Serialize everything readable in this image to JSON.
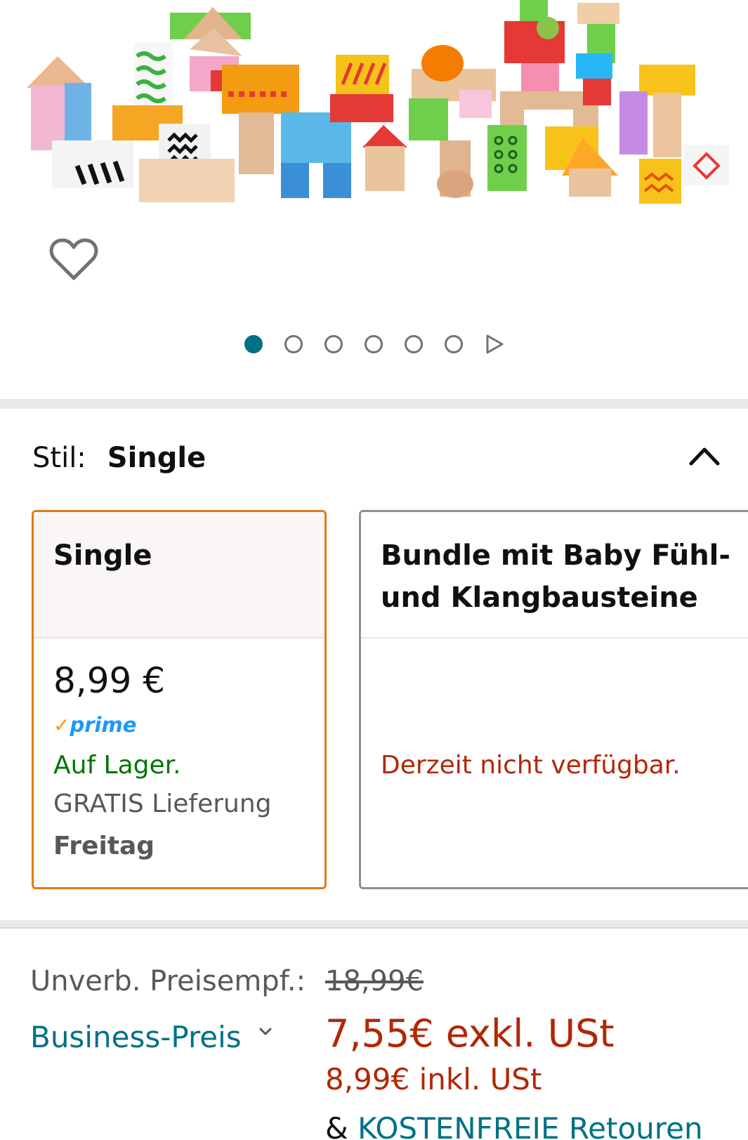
{
  "gallery": {
    "image_alt": "Holzbausteine",
    "wishlist_icon": "heart-outline-icon",
    "dots_total": 6,
    "active_dot_index": 0,
    "next_icon": "play-triangle-icon",
    "colors": {
      "active_dot": "#007185",
      "inactive_dot": "#6f7373"
    }
  },
  "style": {
    "label": "Stil:",
    "value": "Single",
    "toggle_icon": "chevron-up-icon"
  },
  "options": [
    {
      "title": "Single",
      "price": "8,99 €",
      "prime_check": "✓",
      "prime_text": "prime",
      "availability": "Auf Lager.",
      "delivery_label": "GRATIS Lieferung",
      "delivery_day": "Freitag",
      "selected": true
    },
    {
      "title": "Bundle mit Baby Fühl- und Klangbausteine",
      "availability": "Derzeit nicht verfügbar.",
      "selected": false
    }
  ],
  "pricing": {
    "rrp_label": "Unverb. Preisempf.:",
    "rrp_value": "18,99€",
    "business_label": "Business-Preis",
    "price_excl": "7,55€ exkl. USt",
    "price_incl": "8,99€ inkl. USt",
    "returns_prefix": "& ",
    "returns_link": "KOSTENFREIE Retouren"
  },
  "colors": {
    "selected_border": "#e47911",
    "in_stock": "#007600",
    "price_red": "#b12704",
    "link_teal": "#007185",
    "prime_blue": "#1a98ff"
  }
}
